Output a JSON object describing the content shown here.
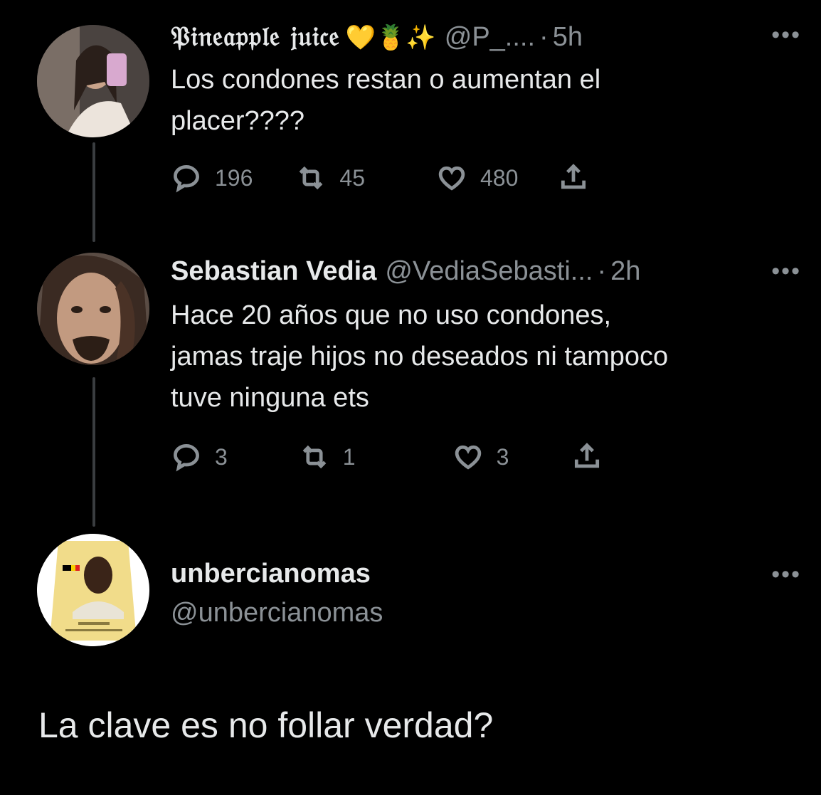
{
  "tweets": [
    {
      "name": "𝔓𝔦𝔫𝔢𝔞𝔭𝔭𝔩𝔢 𝔧𝔲𝔦𝔠𝔢",
      "emojis": "💛🍍✨",
      "handle": "@P_....",
      "dot": "·",
      "time": "5h",
      "text_line1": "Los condones restan o aumentan el",
      "text_line2": "placer????",
      "replies": "196",
      "retweets": "45",
      "likes": "480"
    },
    {
      "name": "Sebastian Vedia",
      "handle": "@VediaSebasti...",
      "dot": "·",
      "time": "2h",
      "text_line1": "Hace 20 años que no uso condones,",
      "text_line2": "jamas traje hijos no deseados ni tampoco",
      "text_line3": "tuve ninguna ets",
      "replies": "3",
      "retweets": "1",
      "likes": "3"
    }
  ],
  "reply": {
    "name": "unbercianomas",
    "handle": "@unbercianomas",
    "text": "La clave es no follar verdad?"
  },
  "more_label": "•••",
  "icons": [
    "reply-icon",
    "retweet-icon",
    "like-icon",
    "share-icon",
    "more-icon"
  ]
}
